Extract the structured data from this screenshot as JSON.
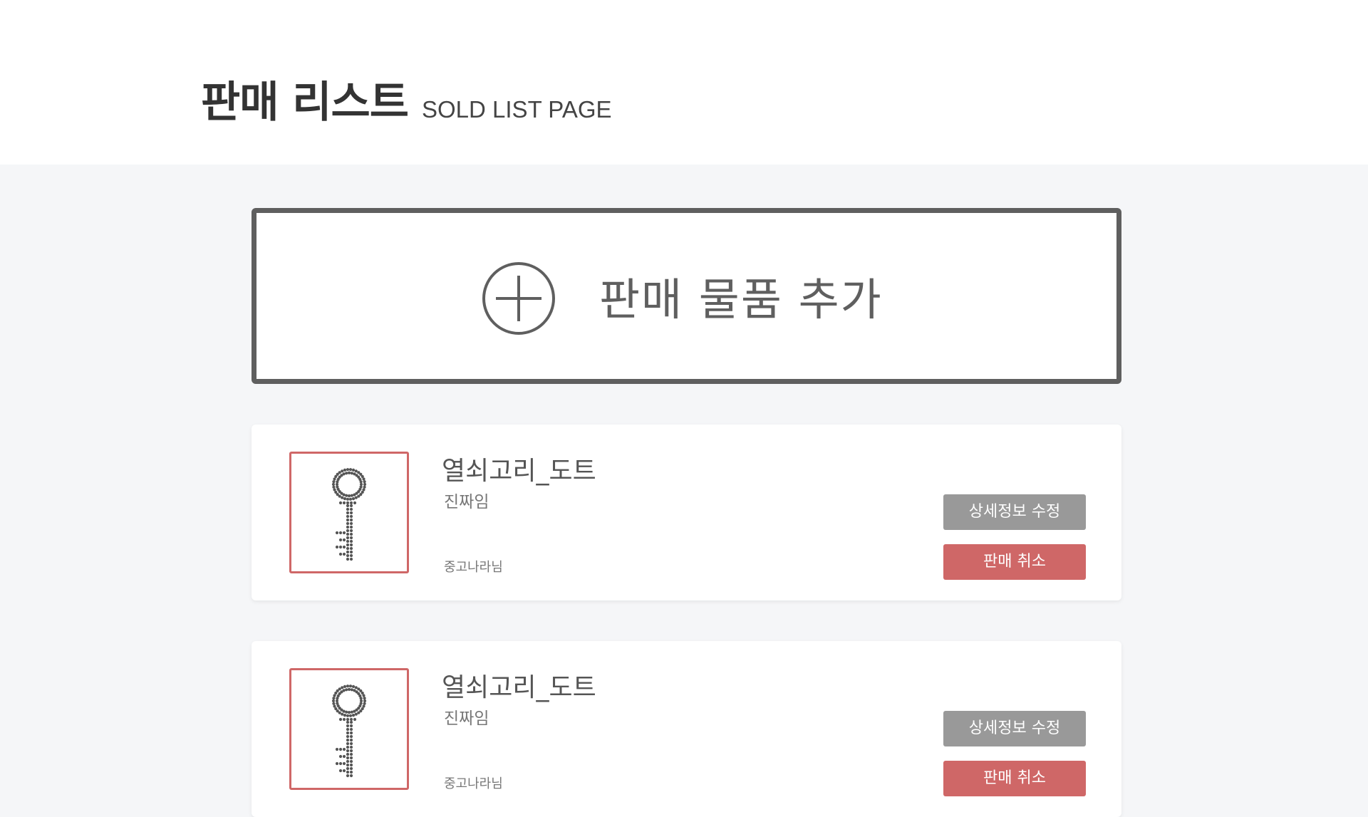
{
  "header": {
    "title": "판매 리스트",
    "subtitle": "SOLD LIST PAGE"
  },
  "add_item": {
    "label": "판매 물품 추가",
    "icon": "plus-circle-icon"
  },
  "items": [
    {
      "title": "열쇠고리_도트",
      "description": "진짜임",
      "seller": "중고나라님",
      "thumbnail_icon": "pixel-key-icon",
      "edit_label": "상세정보 수정",
      "cancel_label": "판매 취소"
    },
    {
      "title": "열쇠고리_도트",
      "description": "진짜임",
      "seller": "중고나라님",
      "thumbnail_icon": "pixel-key-icon",
      "edit_label": "상세정보 수정",
      "cancel_label": "판매 취소"
    }
  ],
  "colors": {
    "accent": "#cf6767",
    "muted_button": "#999999",
    "border_dark": "#5f5f5f",
    "background": "#f5f6f8"
  }
}
